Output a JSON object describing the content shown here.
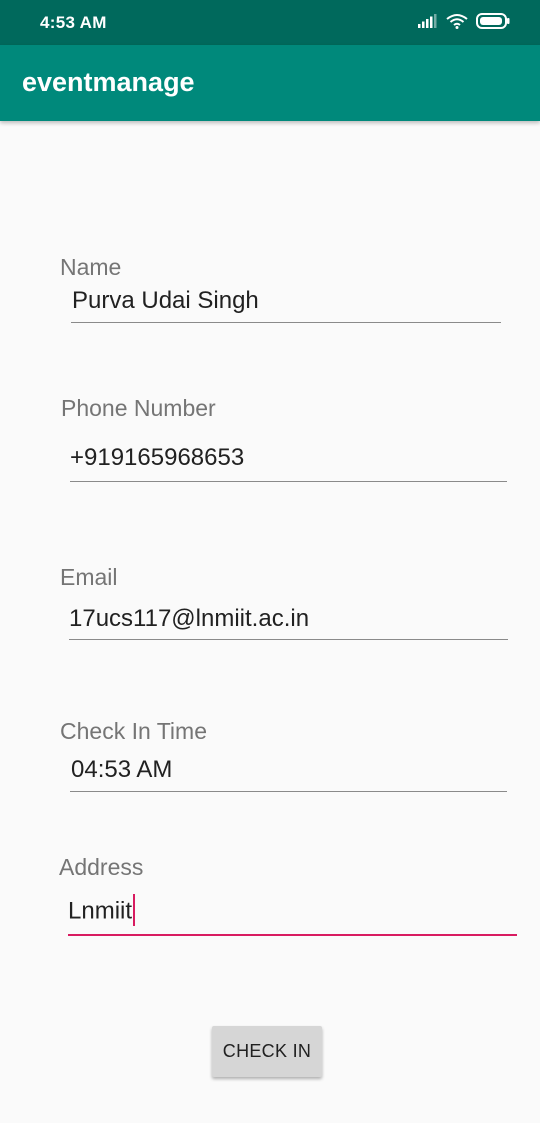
{
  "status_bar": {
    "time": "4:53 AM",
    "icons": [
      "signal-icon",
      "wifi-icon",
      "battery-icon"
    ]
  },
  "app_bar": {
    "title": "eventmanage"
  },
  "form": {
    "name": {
      "label": "Name",
      "value": "Purva Udai Singh"
    },
    "phone": {
      "label": "Phone Number",
      "value": "+919165968653"
    },
    "email": {
      "label": "Email",
      "value": "17ucs117@lnmiit.ac.in"
    },
    "checkin_time": {
      "label": "Check In Time",
      "value": "04:53 AM"
    },
    "address": {
      "label": "Address",
      "value": "Lnmiit"
    }
  },
  "checkin_button": {
    "label": "CHECK IN"
  },
  "colors": {
    "status_bar": "#00695c",
    "app_bar": "#00897b",
    "accent": "#d81b60"
  }
}
